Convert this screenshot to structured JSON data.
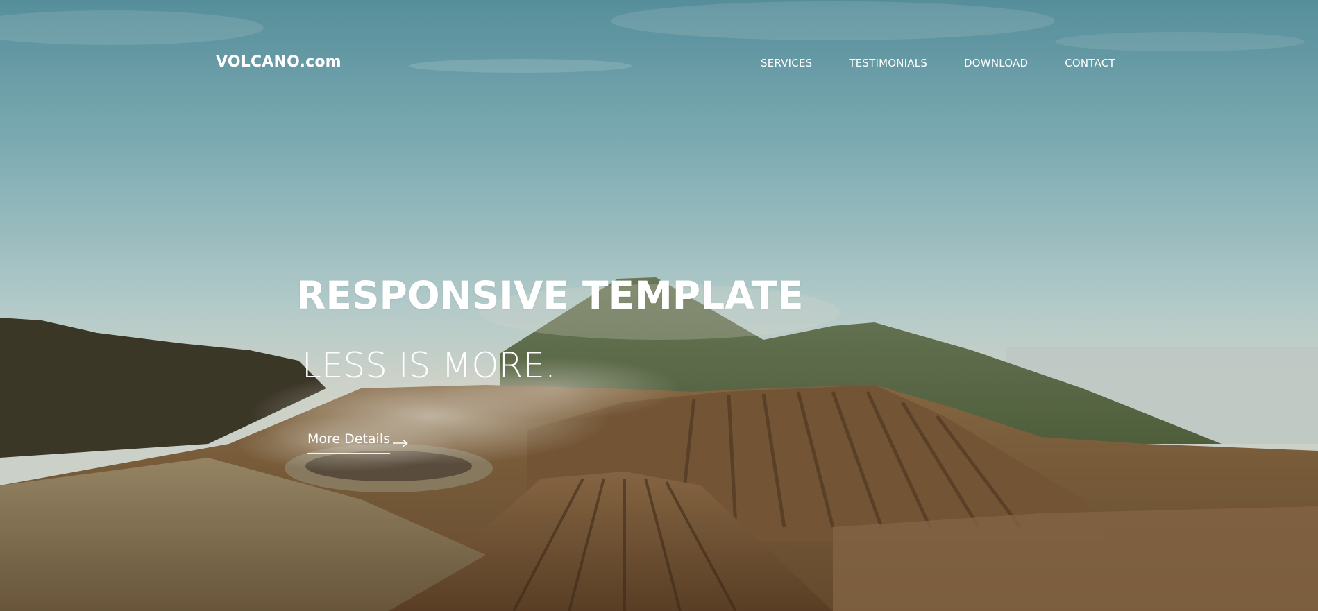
{
  "brand": {
    "name": "VOLCANO.com"
  },
  "nav": {
    "items": [
      {
        "label": "SERVICES"
      },
      {
        "label": "TESTIMONIALS"
      },
      {
        "label": "DOWNLOAD"
      },
      {
        "label": "CONTACT"
      }
    ]
  },
  "hero": {
    "title": "RESPONSIVE TEMPLATE",
    "subtitle": "LESS IS MORE.",
    "cta_label": "More Details",
    "cta_icon": "arrow-right-icon"
  },
  "colors": {
    "text": "#ffffff",
    "sky_top": "#5f9aa6",
    "sky_bottom": "#c6d9d6",
    "ground": "#6e5a3c"
  }
}
